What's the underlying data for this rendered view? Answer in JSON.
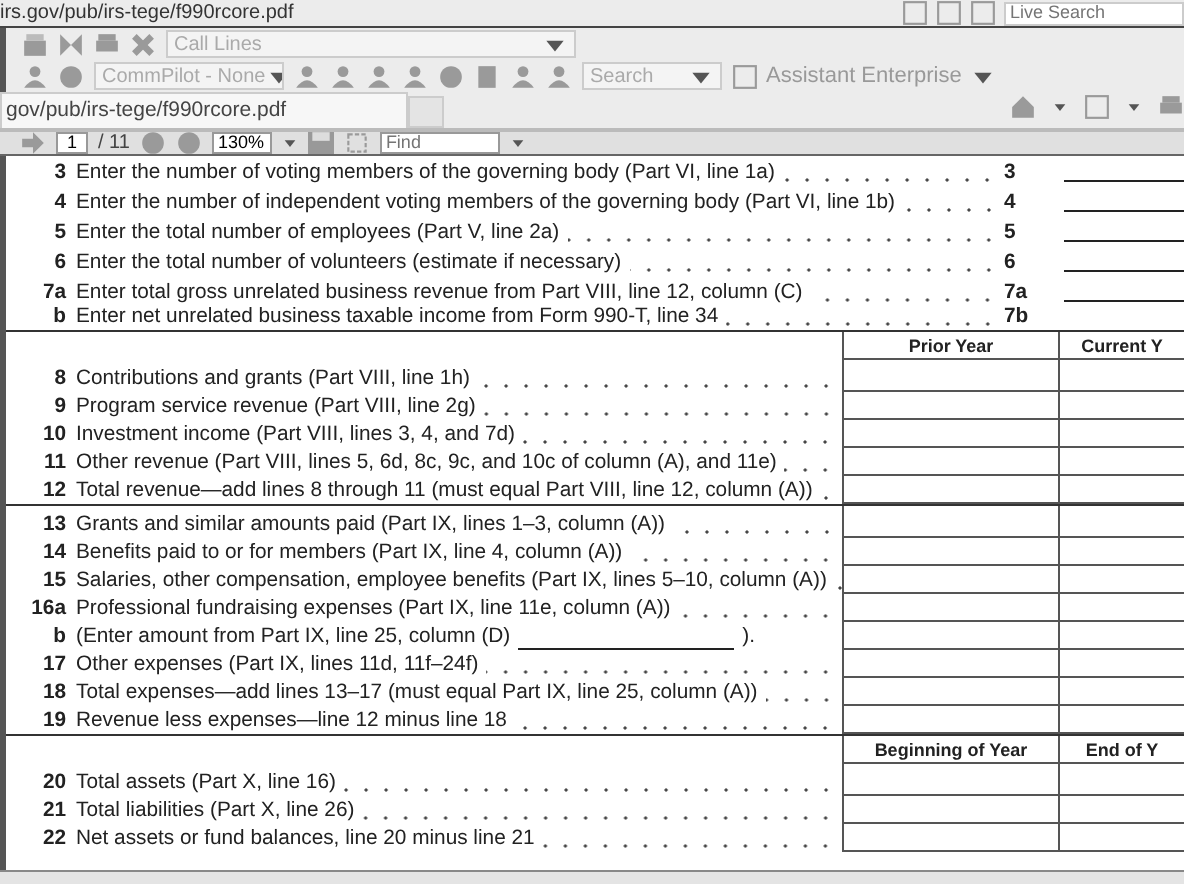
{
  "address_bar": {
    "url": "irs.gov/pub/irs-tege/f990rcore.pdf",
    "search_placeholder": "Live Search"
  },
  "toolbar_1": {
    "call_lines": "Call Lines"
  },
  "toolbar_2": {
    "commpilot": "CommPilot - None",
    "search_placeholder": "Search",
    "assistant": "Assistant Enterprise"
  },
  "tabs": [
    {
      "label": "gov/pub/irs-tege/f990rcore.pdf",
      "selected": true
    }
  ],
  "pdf_toolbar": {
    "page": "1",
    "page_count": "/ 11",
    "zoom": "130%",
    "find_placeholder": "Find"
  },
  "form": {
    "summary_lines": [
      {
        "number": "3",
        "text": "Enter the number of voting members of the governing body (Part VI, line 1a)",
        "ref": "3",
        "answer_line": true
      },
      {
        "number": "4",
        "text": "Enter the number of independent voting members of the governing body (Part VI, line 1b)",
        "ref": "4",
        "answer_line": true
      },
      {
        "number": "5",
        "text": "Enter the total number of employees (Part V, line 2a)",
        "ref": "5",
        "answer_line": true
      },
      {
        "number": "6",
        "text": "Enter the total number of volunteers (estimate if necessary)",
        "ref": "6",
        "answer_line": true
      },
      {
        "number": "7a",
        "text": "Enter total gross unrelated business revenue from Part VIII, line 12, column (C)",
        "ref": "7a",
        "answer_line": true
      },
      {
        "number": "b",
        "text": "Enter net unrelated business taxable income from Form 990-T, line 34",
        "ref": "7b",
        "answer_line": false
      }
    ],
    "sections": [
      {
        "columns": [
          "Prior Year",
          "Current Y"
        ],
        "groups": [
          [
            {
              "number": "8",
              "text": "Contributions and grants (Part VIII, line 1h)"
            },
            {
              "number": "9",
              "text": "Program service revenue (Part VIII, line 2g)"
            },
            {
              "number": "10",
              "text": "Investment income (Part VIII, lines 3, 4, and 7d)"
            },
            {
              "number": "11",
              "text": "Other revenue (Part VIII, lines 5, 6d, 8c, 9c, and 10c of column (A), and 11e)"
            },
            {
              "number": "12",
              "text": "Total revenue—add lines 8 through 11 (must equal Part VIII, line 12, column (A))"
            }
          ],
          [
            {
              "number": "13",
              "text": "Grants and similar amounts paid (Part IX, lines 1–3, column (A))"
            },
            {
              "number": "14",
              "text": "Benefits paid to or for members (Part IX, line 4, column (A))"
            },
            {
              "number": "15",
              "text": "Salaries, other compensation, employee benefits (Part IX, lines 5–10, column (A))"
            },
            {
              "number": "16a",
              "text": "Professional fundraising expenses (Part IX, line 11e, column (A))"
            },
            {
              "number": "b",
              "text": "(Enter amount from Part IX, line 25, column (D)",
              "kind": "fill_in",
              "closing": ")."
            },
            {
              "number": "17",
              "text": "Other expenses (Part IX, lines 11d, 11f–24f)"
            },
            {
              "number": "18",
              "text": "Total expenses—add lines 13–17 (must equal Part IX, line 25, column (A))"
            },
            {
              "number": "19",
              "text": "Revenue less expenses—line 12 minus line 18"
            }
          ]
        ]
      },
      {
        "columns": [
          "Beginning of Year",
          "End of Y"
        ],
        "groups": [
          [
            {
              "number": "20",
              "text": "Total assets (Part X, line 16)"
            },
            {
              "number": "21",
              "text": "Total liabilities (Part X, line 26)"
            },
            {
              "number": "22",
              "text": "Net assets or fund balances, line 20 minus line 21"
            }
          ]
        ]
      }
    ]
  }
}
